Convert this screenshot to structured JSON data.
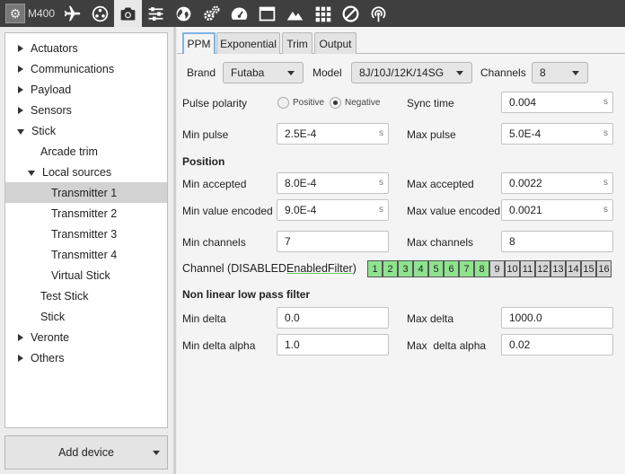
{
  "toolbar": {
    "device_name": "M400",
    "icons": [
      "airplane-icon",
      "joystick-icon",
      "camera-icon",
      "sliders-icon",
      "globe-icon",
      "gears-icon",
      "gauge-icon",
      "window-icon",
      "mountain-icon",
      "grid-icon",
      "disabled-icon",
      "broadcast-icon"
    ],
    "active_icon": "camera-icon"
  },
  "sidebar": {
    "items": [
      {
        "label": "Actuators",
        "level": 0,
        "arrow": "right"
      },
      {
        "label": "Communications",
        "level": 0,
        "arrow": "right"
      },
      {
        "label": "Payload",
        "level": 0,
        "arrow": "right"
      },
      {
        "label": "Sensors",
        "level": 0,
        "arrow": "right"
      },
      {
        "label": "Stick",
        "level": 0,
        "arrow": "down"
      },
      {
        "label": "Arcade trim",
        "level": 1,
        "arrow": ""
      },
      {
        "label": "Local sources",
        "level": 1,
        "arrow": "down"
      },
      {
        "label": "Transmitter 1",
        "level": 2,
        "arrow": "",
        "selected": true
      },
      {
        "label": "Transmitter 2",
        "level": 2,
        "arrow": ""
      },
      {
        "label": "Transmitter 3",
        "level": 2,
        "arrow": ""
      },
      {
        "label": "Transmitter 4",
        "level": 2,
        "arrow": ""
      },
      {
        "label": "Virtual Stick",
        "level": 2,
        "arrow": ""
      },
      {
        "label": "Test Stick",
        "level": 1,
        "arrow": ""
      },
      {
        "label": "Stick",
        "level": 1,
        "arrow": ""
      },
      {
        "label": "Veronte",
        "level": 0,
        "arrow": "right"
      },
      {
        "label": "Others",
        "level": 0,
        "arrow": "right"
      }
    ],
    "add_device_label": "Add device"
  },
  "tabs": [
    "PPM",
    "Exponential",
    "Trim",
    "Output"
  ],
  "active_tab": "PPM",
  "form": {
    "brand_label": "Brand",
    "brand_value": "Futaba",
    "model_label": "Model",
    "model_value": "8J/10J/12K/14SG",
    "channels_label": "Channels",
    "channels_value": "8",
    "pulse_polarity_label": "Pulse polarity",
    "positive_label": "Positive",
    "negative_label": "Negative",
    "polarity_selected": "Negative",
    "sync_time_label": "Sync time",
    "sync_time_value": "0.004",
    "min_pulse_label": "Min pulse",
    "min_pulse_value": "2.5E-4",
    "max_pulse_label": "Max pulse",
    "max_pulse_value": "5.0E-4",
    "unit_s": "s",
    "position_heading": "Position",
    "min_accepted_label": "Min accepted",
    "min_accepted_value": "8.0E-4",
    "max_accepted_label": "Max accepted",
    "max_accepted_value": "0.0022",
    "min_value_encoded_label": "Min value encoded",
    "min_value_encoded_value": "9.0E-4",
    "max_value_encoded_label": "Max value encoded",
    "max_value_encoded_value": "0.0021",
    "min_channels_label": "Min channels",
    "min_channels_value": "7",
    "max_channels_label": "Max channels",
    "max_channels_value": "8",
    "channel_legend_prefix": "Channel (",
    "channel_legend_disabled": "DISABLED",
    "channel_legend_enabled": "Enabled",
    "channel_legend_filter": "Filter",
    "channel_legend_suffix": ")",
    "channels": [
      {
        "n": "1",
        "enabled": true
      },
      {
        "n": "2",
        "enabled": true
      },
      {
        "n": "3",
        "enabled": true
      },
      {
        "n": "4",
        "enabled": true
      },
      {
        "n": "5",
        "enabled": true
      },
      {
        "n": "6",
        "enabled": true
      },
      {
        "n": "7",
        "enabled": true
      },
      {
        "n": "8",
        "enabled": true
      },
      {
        "n": "9",
        "enabled": false
      },
      {
        "n": "10",
        "enabled": false
      },
      {
        "n": "11",
        "enabled": false
      },
      {
        "n": "12",
        "enabled": false
      },
      {
        "n": "13",
        "enabled": false
      },
      {
        "n": "14",
        "enabled": false
      },
      {
        "n": "15",
        "enabled": false
      },
      {
        "n": "16",
        "enabled": false
      }
    ],
    "channel_enabled_color": "#8fe38f",
    "channel_disabled_color": "#d6d6d6",
    "nonlinear_heading": "Non linear low pass filter",
    "min_delta_label": "Min delta",
    "min_delta_value": "0.0",
    "max_delta_label": "Max delta",
    "max_delta_value": "1000.0",
    "min_delta_alpha_label": "Min delta alpha",
    "min_delta_alpha_value": "1.0",
    "max_delta_alpha_label": "Max  delta alpha",
    "max_delta_alpha_value": "0.02"
  },
  "colors": {
    "toolbar_bg": "#3f3f3f",
    "tab_active_border": "#7cb4e6",
    "selected_row": "#d2d2d2"
  }
}
